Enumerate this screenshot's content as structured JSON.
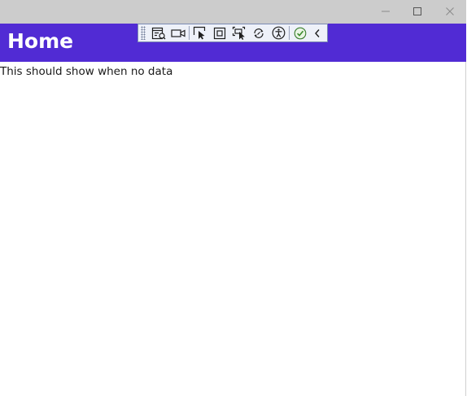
{
  "window": {
    "caption_buttons": {
      "minimize_icon": "minimize-icon",
      "maximize_icon": "maximize-icon",
      "close_icon": "close-icon"
    }
  },
  "header": {
    "title": "Home",
    "background_color": "#512bd4",
    "text_color": "#ffffff"
  },
  "debug_toolbar": {
    "tools": [
      "live-visual-tree-icon",
      "video-camera-icon",
      "select-element-icon",
      "display-layout-adorners-icon",
      "track-focused-element-icon",
      "hot-reload-icon",
      "accessibility-icon",
      "binding-failures-check-icon",
      "collapse-chevron-icon"
    ]
  },
  "main": {
    "empty_message": "This should show when no data"
  }
}
